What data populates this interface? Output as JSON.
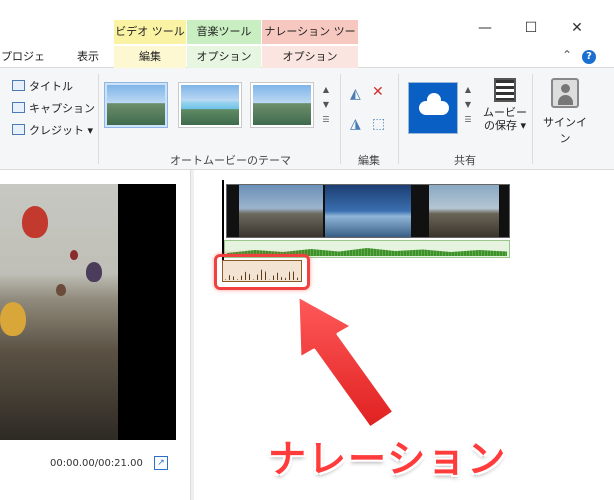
{
  "context_tabs": [
    {
      "label": "ビデオ ツール",
      "color": "#fbf3a4"
    },
    {
      "label": "音楽ツール",
      "color": "#c9eec1"
    },
    {
      "label": "ナレーション ツール",
      "color": "#f7c8c0"
    }
  ],
  "ribbon_tabs": [
    "プロジェクト",
    "表示",
    "編集",
    "オプション",
    "オプション"
  ],
  "window_controls": {
    "minimize": "—",
    "maximize": "☐",
    "close": "✕"
  },
  "text_buttons": {
    "title": "タイトル",
    "caption": "キャプション",
    "credit": "クレジット"
  },
  "groups": {
    "theme": "オートムービーのテーマ",
    "edit": "編集",
    "share": "共有"
  },
  "buttons": {
    "save_movie_line1": "ムービー",
    "save_movie_line2": "の保存",
    "signin": "サインイン"
  },
  "preview": {
    "timecode": "00:00.00/00:21.00"
  },
  "annotation": {
    "label": "ナレーション",
    "color": "#ff3b3b"
  }
}
